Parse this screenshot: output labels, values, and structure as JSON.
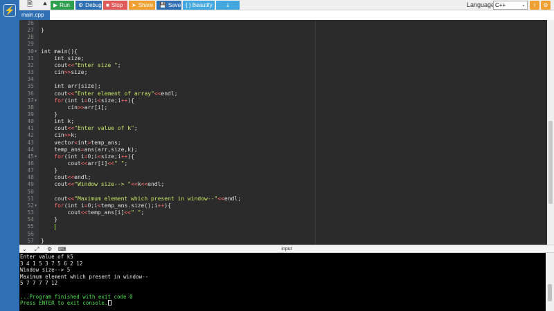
{
  "toolbar": {
    "icons": [
      "new-file-icon",
      "folder-icon",
      "upload-icon"
    ],
    "run_label": "Run",
    "debug_label": "Debug",
    "stop_label": "Stop",
    "share_label": "Share",
    "save_label": "Save",
    "beautify_label": "{ } Beautify",
    "language_label": "Language",
    "language_value": "C++",
    "colors": {
      "run": "#2e9e4f",
      "debug": "#2f6fb4",
      "stop": "#e05a5a",
      "share": "#f0a030",
      "save": "#2f6fb4",
      "beautify": "#43a8e0",
      "download": "#43a8e0"
    }
  },
  "tab": {
    "filename": "main.cpp"
  },
  "editor": {
    "lines": [
      {
        "n": "26",
        "t": ""
      },
      {
        "n": "27",
        "t": "}"
      },
      {
        "n": "28",
        "t": ""
      },
      {
        "n": "29",
        "t": ""
      },
      {
        "n": "30",
        "t": "int main(){",
        "fold": true
      },
      {
        "n": "31",
        "t": "    int size;"
      },
      {
        "n": "32",
        "t": "    cout<<\"Enter size \";"
      },
      {
        "n": "33",
        "t": "    cin>>size;"
      },
      {
        "n": "34",
        "t": ""
      },
      {
        "n": "35",
        "t": "    int arr[size];"
      },
      {
        "n": "36",
        "t": "    cout<<\"Enter element of array\"<<endl;"
      },
      {
        "n": "37",
        "t": "    for(int i=0;i<size;i++){",
        "fold": true
      },
      {
        "n": "38",
        "t": "        cin>>arr[i];"
      },
      {
        "n": "39",
        "t": "    }"
      },
      {
        "n": "40",
        "t": "    int k;"
      },
      {
        "n": "41",
        "t": "    cout<<\"Enter value of k\";"
      },
      {
        "n": "42",
        "t": "    cin>>k;"
      },
      {
        "n": "43",
        "t": "    vector<int>temp_ans;"
      },
      {
        "n": "44",
        "t": "    temp_ans=ans(arr,size,k);"
      },
      {
        "n": "45",
        "t": "    for(int i=0;i<size;i++){",
        "fold": true
      },
      {
        "n": "46",
        "t": "        cout<<arr[i]<<\" \";"
      },
      {
        "n": "47",
        "t": "    }"
      },
      {
        "n": "48",
        "t": "    cout<<endl;"
      },
      {
        "n": "49",
        "t": "    cout<<\"Window size--> \"<<k<<endl;"
      },
      {
        "n": "50",
        "t": ""
      },
      {
        "n": "51",
        "t": "    cout<<\"Maximum element which present in window--\"<<endl;"
      },
      {
        "n": "52",
        "t": "    for(int i=0;i<temp_ans.size();i++){",
        "fold": true
      },
      {
        "n": "53",
        "t": "        cout<<temp_ans[i]<<\" \";"
      },
      {
        "n": "54",
        "t": "    }"
      },
      {
        "n": "55",
        "t": "    "
      },
      {
        "n": "56",
        "t": ""
      },
      {
        "n": "57",
        "t": "}"
      }
    ],
    "cursor_line": "55"
  },
  "io_panel": {
    "title": "input",
    "icons": [
      "chevron-down-icon",
      "expand-icon",
      "gear-icon",
      "keyboard-icon"
    ]
  },
  "console": {
    "lines": [
      {
        "t": "Enter value of k5",
        "style": "normal"
      },
      {
        "t": "3 4 1 5 3 7 5 6 2 12",
        "style": "normal"
      },
      {
        "t": "Window size--> 5",
        "style": "normal"
      },
      {
        "t": "Maximum element which present in window--",
        "style": "normal"
      },
      {
        "t": "5 7 7 7 7 12",
        "style": "normal"
      },
      {
        "t": "",
        "style": "normal"
      },
      {
        "t": "...Program finished with exit code 0",
        "style": "green"
      },
      {
        "t": "Press ENTER to exit console.",
        "style": "green"
      }
    ]
  }
}
